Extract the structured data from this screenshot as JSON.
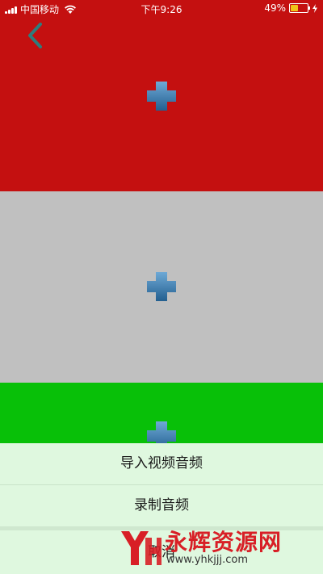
{
  "status_bar": {
    "carrier": "中国移动",
    "time": "下午9:26",
    "battery_percent": "49%",
    "battery_level": 0.49,
    "wifi_icon": "wifi-icon",
    "charging_icon": "bolt-icon"
  },
  "nav": {
    "back_icon": "chevron-left-icon",
    "back_color": "#2e7d7d"
  },
  "panels": [
    {
      "name": "red",
      "color": "#c41010",
      "icon": "plus-icon"
    },
    {
      "name": "gray",
      "color": "#c0c0c0",
      "icon": "plus-icon"
    },
    {
      "name": "green",
      "color": "#08c008",
      "icon": "plus-icon"
    }
  ],
  "action_sheet": {
    "import_label": "导入视频音频",
    "record_label": "录制音频",
    "cancel_label": "取消"
  },
  "watermark": {
    "title": "永辉资源网",
    "url": "www.yhkjjj.com"
  }
}
